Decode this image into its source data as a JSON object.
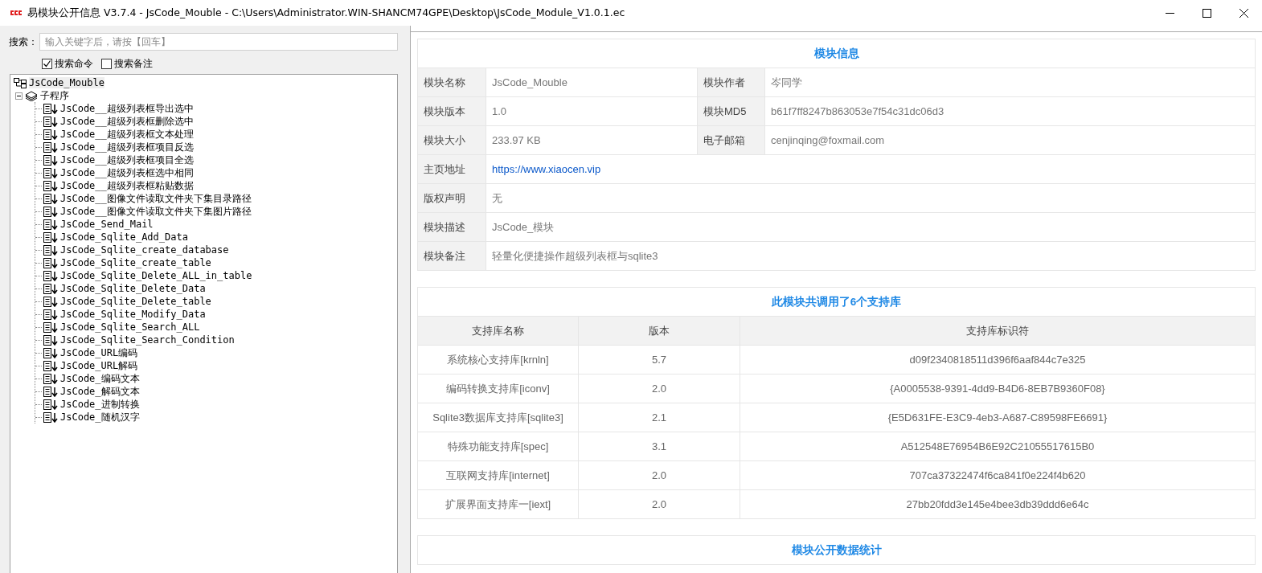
{
  "window": {
    "title": "易模块公开信息 V3.7.4 - JsCode_Mouble - C:\\Users\\Administrator.WIN-SHANCM74GPE\\Desktop\\JsCode_Module_V1.0.1.ec"
  },
  "search": {
    "label": "搜索：",
    "placeholder": "输入关键字后，请按【回车】"
  },
  "options": [
    {
      "label": "搜索命令",
      "checked": true
    },
    {
      "label": "搜索备注",
      "checked": false
    }
  ],
  "tree": [
    {
      "label": "JsCode_Mouble",
      "kind": "module",
      "children": [
        {
          "label": "子程序",
          "kind": "folder",
          "expanded": true,
          "children": [
            {
              "label": "JsCode__超级列表框导出选中",
              "kind": "sub"
            },
            {
              "label": "JsCode__超级列表框删除选中",
              "kind": "sub"
            },
            {
              "label": "JsCode__超级列表框文本处理",
              "kind": "sub"
            },
            {
              "label": "JsCode__超级列表框项目反选",
              "kind": "sub"
            },
            {
              "label": "JsCode__超级列表框项目全选",
              "kind": "sub"
            },
            {
              "label": "JsCode__超级列表框选中相同",
              "kind": "sub"
            },
            {
              "label": "JsCode__超级列表框粘贴数据",
              "kind": "sub"
            },
            {
              "label": "JsCode__图像文件读取文件夹下集目录路径",
              "kind": "sub"
            },
            {
              "label": "JsCode__图像文件读取文件夹下集图片路径",
              "kind": "sub"
            },
            {
              "label": "JsCode_Send_Mail",
              "kind": "sub"
            },
            {
              "label": "JsCode_Sqlite_Add_Data",
              "kind": "sub"
            },
            {
              "label": "JsCode_Sqlite_create_database",
              "kind": "sub"
            },
            {
              "label": "JsCode_Sqlite_create_table",
              "kind": "sub"
            },
            {
              "label": "JsCode_Sqlite_Delete_ALL_in_table",
              "kind": "sub"
            },
            {
              "label": "JsCode_Sqlite_Delete_Data",
              "kind": "sub"
            },
            {
              "label": "JsCode_Sqlite_Delete_table",
              "kind": "sub"
            },
            {
              "label": "JsCode_Sqlite_Modify_Data",
              "kind": "sub"
            },
            {
              "label": "JsCode_Sqlite_Search_ALL",
              "kind": "sub"
            },
            {
              "label": "JsCode_Sqlite_Search_Condition",
              "kind": "sub"
            },
            {
              "label": "JsCode_URL编码",
              "kind": "sub"
            },
            {
              "label": "JsCode_URL解码",
              "kind": "sub"
            },
            {
              "label": "JsCode_编码文本",
              "kind": "sub"
            },
            {
              "label": "JsCode_解码文本",
              "kind": "sub"
            },
            {
              "label": "JsCode_进制转换",
              "kind": "sub"
            },
            {
              "label": "JsCode_随机汉字",
              "kind": "sub"
            }
          ]
        }
      ]
    }
  ],
  "module_info": {
    "title": "模块信息",
    "rows": [
      {
        "cells": [
          {
            "label": "模块名称",
            "value": "JsCode_Mouble"
          },
          {
            "label": "模块作者",
            "value": "岑同学"
          }
        ]
      },
      {
        "cells": [
          {
            "label": "模块版本",
            "value": "1.0"
          },
          {
            "label": "模块MD5",
            "value": "b61f7ff8247b863053e7f54c31dc06d3"
          }
        ]
      },
      {
        "cells": [
          {
            "label": "模块大小",
            "value": "233.97 KB"
          },
          {
            "label": "电子邮箱",
            "value": "cenjinqing@foxmail.com"
          }
        ]
      },
      {
        "cells": [
          {
            "label": "主页地址",
            "value": "https://www.xiaocen.vip",
            "kind": "link"
          }
        ]
      },
      {
        "cells": [
          {
            "label": "版权声明",
            "value": "无"
          }
        ]
      },
      {
        "cells": [
          {
            "label": "模块描述",
            "value": "JsCode_模块"
          }
        ]
      },
      {
        "cells": [
          {
            "label": "模块备注",
            "value": "轻量化便捷操作超级列表框与sqlite3"
          }
        ]
      }
    ]
  },
  "libraries": {
    "title": "此模块共调用了6个支持库",
    "columns": [
      "支持库名称",
      "版本",
      "支持库标识符"
    ],
    "rows": [
      [
        "系统核心支持库[krnln]",
        "5.7",
        "d09f2340818511d396f6aaf844c7e325"
      ],
      [
        "编码转换支持库[iconv]",
        "2.0",
        "{A0005538-9391-4dd9-B4D6-8EB7B9360F08}"
      ],
      [
        "Sqlite3数据库支持库[sqlite3]",
        "2.1",
        "{E5D631FE-E3C9-4eb3-A687-C89598FE6691}"
      ],
      [
        "特殊功能支持库[spec]",
        "3.1",
        "A512548E76954B6E92C21055517615B0"
      ],
      [
        "互联网支持库[internet]",
        "2.0",
        "707ca37322474f6ca841f0e224f4b620"
      ],
      [
        "扩展界面支持库一[iext]",
        "2.0",
        "27bb20fdd3e145e4bee3db39ddd6e64c"
      ]
    ]
  },
  "stats": {
    "title": "模块公开数据统计"
  }
}
